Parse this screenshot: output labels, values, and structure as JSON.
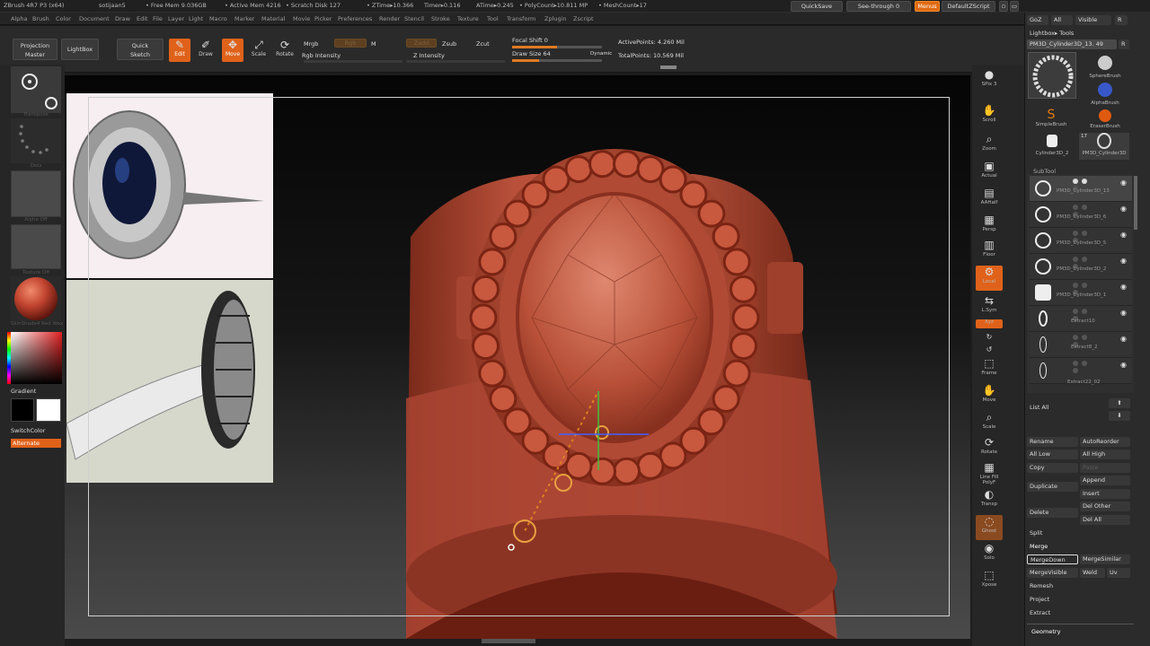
{
  "titlebar": {
    "app": "ZBrush 4R7 P3 (x64)",
    "user": "sotijaan5",
    "free_mem": "• Free Mem 9.036GB",
    "active_mem": "• Active Mem 4216",
    "scratch": "• Scratch Disk 127",
    "ztime": "• ZTime▸10.366",
    "timer": "Timer▸0.116",
    "atime": "ATime▸0.245",
    "polycount": "• PolyCount▸10.811 MP",
    "meshcount": "• MeshCount▸17",
    "quicksave": "QuickSave",
    "see_through": "See-through  0",
    "menus": "Menus",
    "defaultzscript": "DefaultZScript"
  },
  "menubar": [
    "Alpha",
    "Brush",
    "Color",
    "Document",
    "Draw",
    "Edit",
    "File",
    "Layer",
    "Light",
    "Macro",
    "Marker",
    "Material",
    "Movie",
    "Picker",
    "Preferences",
    "Render",
    "Stencil",
    "Stroke",
    "Texture",
    "Tool",
    "Transform",
    "Zplugin",
    "Zscript"
  ],
  "topshelf": {
    "projection_master": "Projection\nMaster",
    "lightbox": "LightBox",
    "quick_sketch": "Quick\nSketch",
    "edit": "Edit",
    "draw": "Draw",
    "move": "Move",
    "scale": "Scale",
    "rotate": "Rotate",
    "mrgb": "Mrgb",
    "rgb": "Rgb",
    "m": "M",
    "zadd": "Zadd",
    "zsub": "Zsub",
    "zcut": "Zcut",
    "rgb_intensity": "Rgb Intensity",
    "z_intensity": "Z Intensity",
    "focal_shift": "Focal Shift 0",
    "draw_size": "Draw Size 64",
    "dynamic": "Dynamic",
    "active_points": "ActivePoints: 4.260 Mil",
    "total_points": "TotalPoints: 10.569 Mil",
    "focal_shift_value": 0.5,
    "draw_size_value": 0.3
  },
  "leftshelf": {
    "brush_caption": "Transpose",
    "stroke_caption": "Dots",
    "alpha_caption": "Alpha Off",
    "texture_caption": "Texture Off",
    "material_caption": "SkinShade4  Red Wax",
    "gradient": "Gradient",
    "switchcolor": "SwitchColor",
    "alternate": "Alternate"
  },
  "rightstrip": [
    "SPix 3",
    "Scroll",
    "Zoom",
    "Actual",
    "AAHalf",
    "Persp",
    "Floor",
    "Local",
    "L.Sym",
    "Xyz",
    "",
    "",
    "Frame",
    "Move",
    "Scale",
    "Rotate",
    "Line Fill PolyF",
    "Transp",
    "Ghost",
    "Solo",
    "Xpose"
  ],
  "rightpanel": {
    "goz": "GoZ",
    "all": "All",
    "visible": "Visible",
    "r": "R",
    "lightbox_tools": "Lightbox▸ Tools",
    "current_tool": "PM3D_Cylinder3D_13. 49",
    "thumb_spheres": "SphereBrush",
    "thumb_alphabrush": "AlphaBrush",
    "thumb_simple": "SimpleBrush",
    "thumb_eraser": "EraserBrush",
    "thumb_cyl": "Cylinder3D_2",
    "thumb_pm3d": "PM3D_Cylinder3D",
    "count_17": "17",
    "subtool": "SubTool",
    "subtools": [
      "PM3D_Cylinder3D_13",
      "PM3D_Cylinder3D_6",
      "PM3D_Cylinder3D_5",
      "PM3D_Cylinder3D_2",
      "PM3D_Cylinder3D_1",
      "Extract10",
      "Extract8_2",
      "Extract22_02"
    ],
    "list_all": "List All",
    "rename": "Rename",
    "autoreorder": "AutoReorder",
    "all_low": "All Low",
    "all_high": "All High",
    "copy": "Copy",
    "paste": "Paste",
    "append": "Append",
    "duplicate": "Duplicate",
    "insert": "Insert",
    "del_other": "Del Other",
    "delete": "Delete",
    "del_all": "Del All",
    "split": "Split",
    "merge": "Merge",
    "mergedown": "MergeDown",
    "mergesimilar": "MergeSimilar",
    "mergevisible": "MergeVisible",
    "weld": "Weld",
    "uv": "Uv",
    "remesh": "Remesh",
    "project": "Project",
    "extract": "Extract",
    "geometry": "Geometry"
  },
  "colors": {
    "accent": "#e0621a",
    "model": "#b24a35",
    "primary_color": "#000000",
    "secondary_color": "#ffffff"
  }
}
